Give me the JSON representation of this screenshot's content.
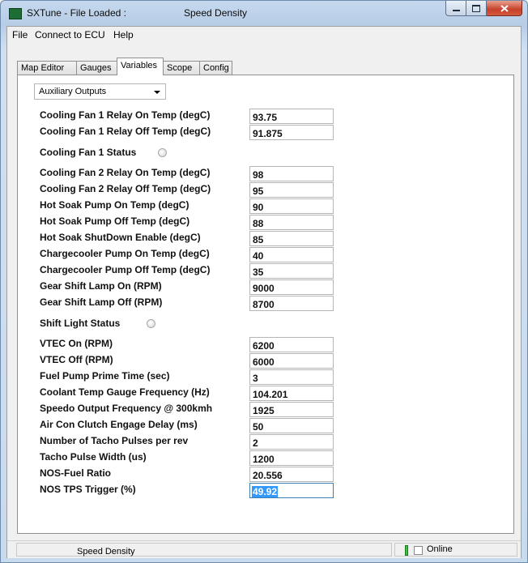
{
  "window": {
    "title": "SXTune - File Loaded :",
    "mode_title": "Speed Density",
    "minimize_symbol": "–",
    "maximize_symbol": "□",
    "close_symbol": "✕"
  },
  "menu": [
    "File",
    "Connect to ECU",
    "Help"
  ],
  "tabs": [
    "Map Editor",
    "Gauges",
    "Variables",
    "Scope",
    "Config"
  ],
  "active_tab": "Variables",
  "category_dropdown": {
    "selected": "Auxiliary Outputs"
  },
  "variables": [
    {
      "label": "Cooling Fan 1 Relay On Temp (degC)",
      "value": "93.75"
    },
    {
      "label": "Cooling Fan 1 Relay Off Temp (degC)",
      "value": "91.875"
    },
    {
      "label": "Cooling Fan 1 Status",
      "type": "status"
    },
    {
      "label": "Cooling Fan 2 Relay On Temp (degC)",
      "value": "98"
    },
    {
      "label": "Cooling Fan 2 Relay Off Temp (degC)",
      "value": "95"
    },
    {
      "label": "Hot Soak Pump On Temp (degC)",
      "value": "90"
    },
    {
      "label": "Hot Soak Pump Off Temp (degC)",
      "value": "88"
    },
    {
      "label": "Hot Soak ShutDown Enable (degC)",
      "value": "85"
    },
    {
      "label": "Chargecooler Pump On Temp (degC)",
      "value": "40"
    },
    {
      "label": "Chargecooler Pump Off Temp (degC)",
      "value": "35"
    },
    {
      "label": "Gear Shift Lamp On (RPM)",
      "value": "9000"
    },
    {
      "label": "Gear Shift Lamp Off (RPM)",
      "value": "8700"
    },
    {
      "label": "Shift Light Status",
      "type": "status"
    },
    {
      "label": "VTEC On (RPM)",
      "value": "6200"
    },
    {
      "label": "VTEC Off (RPM)",
      "value": "6000"
    },
    {
      "label": "Fuel Pump Prime Time (sec)",
      "value": "3"
    },
    {
      "label": "Coolant Temp Gauge Frequency (Hz)",
      "value": "104.201"
    },
    {
      "label": "Speedo Output Frequency @ 300kmh",
      "value": "1925"
    },
    {
      "label": "Air Con Clutch Engage Delay (ms)",
      "value": "50"
    },
    {
      "label": "Number of Tacho Pulses per rev",
      "value": "2"
    },
    {
      "label": "Tacho Pulse Width (us)",
      "value": "1200"
    },
    {
      "label": "NOS-Fuel Ratio",
      "value": "20.556"
    },
    {
      "label": "NOS TPS Trigger (%)",
      "value": "49.92"
    }
  ],
  "statusbar": {
    "mode": "Speed Density",
    "online_label": "Online"
  }
}
